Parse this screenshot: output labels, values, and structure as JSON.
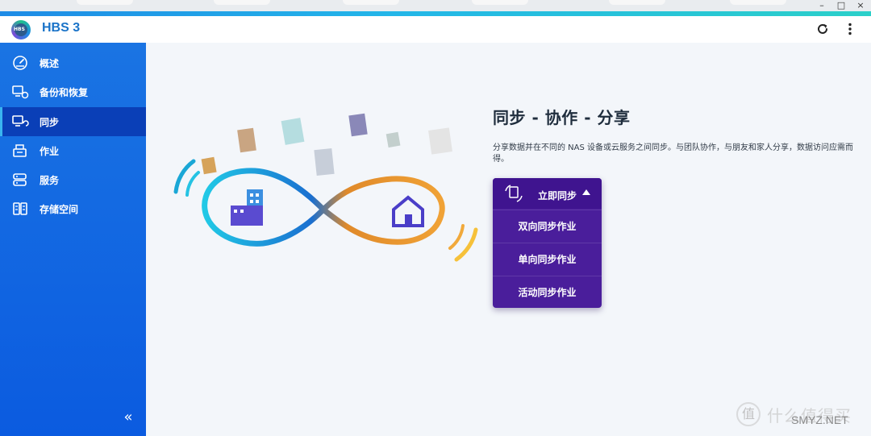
{
  "window": {
    "minimize_glyph": "–",
    "maximize_glyph": "□",
    "close_glyph": "×"
  },
  "header": {
    "app_title": "HBS 3",
    "logo_text": "HBS",
    "refresh_icon": "refresh-icon",
    "more_icon": "more-vertical-icon"
  },
  "sidebar": {
    "items": [
      {
        "label": "概述",
        "icon": "dashboard-icon",
        "active": false
      },
      {
        "label": "备份和恢复",
        "icon": "backup-restore-icon",
        "active": false
      },
      {
        "label": "同步",
        "icon": "sync-icon",
        "active": true
      },
      {
        "label": "作业",
        "icon": "jobs-icon",
        "active": false
      },
      {
        "label": "服务",
        "icon": "services-icon",
        "active": false
      },
      {
        "label": "存储空间",
        "icon": "storage-icon",
        "active": false
      }
    ],
    "collapse_glyph": "«"
  },
  "main": {
    "title": "同步 - 协作 - 分享",
    "description": "分享数据并在不同的 NAS 设备或云服务之间同步。与团队协作，与朋友和家人分享，数据访问应需而得。",
    "sync_menu": {
      "header_label": "立即同步",
      "options": [
        "双向同步作业",
        "单向同步作业",
        "活动同步作业"
      ]
    }
  },
  "watermark": {
    "logo_char": "值",
    "text": "什么值得买",
    "sub": "SMYZ.NET"
  },
  "colors": {
    "sidebar": "#0b5be0",
    "active_item": "#0a3fb7",
    "sync_panel": "#4a1e9b",
    "title_blue": "#1a73c8"
  }
}
